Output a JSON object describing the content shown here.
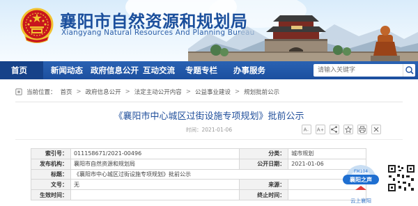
{
  "header": {
    "title_cn": "襄阳市自然资源和规划局",
    "title_en": "Xiangyang Natural Resources And Planning Bureau",
    "emblem_icon": "national-emblem-icon",
    "colors": {
      "brand": "#1b4f9c",
      "nav": "#1c4f9f",
      "accent": "#c8161d"
    }
  },
  "nav": {
    "items": [
      {
        "label": "首页"
      },
      {
        "label": "新闻动态"
      },
      {
        "label": "政府信息公开"
      },
      {
        "label": "互动交流"
      },
      {
        "label": "专题专栏"
      },
      {
        "label": "办事服务"
      }
    ],
    "search_placeholder": "请输入关键字"
  },
  "breadcrumb": {
    "prefix": "当前位置：",
    "items": [
      "首页",
      "政府信息公开",
      "法定主动公开内容",
      "公益事业建设",
      "规划批前公示"
    ],
    "separator": ">"
  },
  "article": {
    "title": "《襄阳市中心城区过街设施专项规划》批前公示",
    "date_label": "时间：",
    "date": "2021-01-06",
    "share_icons": [
      "font-size-small-icon",
      "font-size-large-icon",
      "share-icon",
      "favorite-icon",
      "print-icon",
      "close-icon"
    ]
  },
  "info_table": {
    "rows": [
      [
        {
          "label": "索引号：",
          "value": "011158671/2021-00496"
        },
        {
          "label": "分类：",
          "value": "城市规划"
        }
      ],
      [
        {
          "label": "发布机构：",
          "value": "襄阳市自然资源和规划局"
        },
        {
          "label": "公开日期：",
          "value": "2021-01-06"
        }
      ],
      [
        {
          "label": "标题：",
          "value": "《襄阳市中心城区过街设施专项规划》批前公示"
        }
      ],
      [
        {
          "label": "文号：",
          "value": "无"
        },
        {
          "label": "来源：",
          "value": ""
        }
      ],
      [
        {
          "label": "生效时间：",
          "value": ""
        },
        {
          "label": "终止时间：",
          "value": ""
        }
      ]
    ]
  },
  "badges": {
    "fm_top": "FM104",
    "fm_brand": "襄阳之声",
    "fm_slogan": "云上襄阳"
  }
}
